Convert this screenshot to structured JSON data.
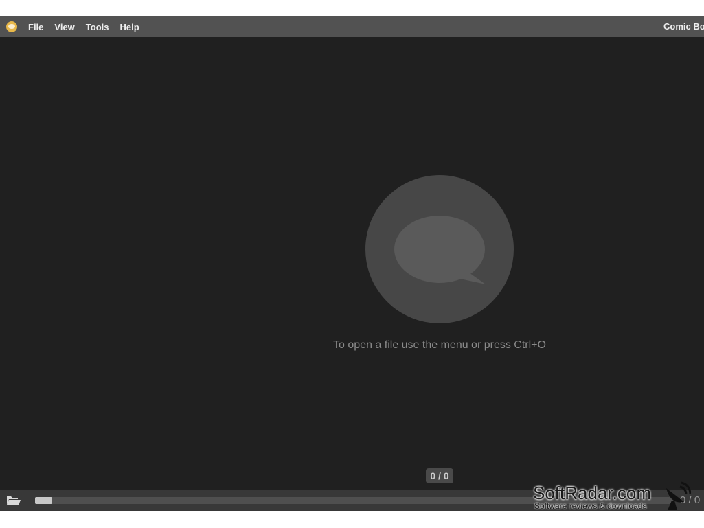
{
  "menubar": {
    "app_icon": "app-logo-icon",
    "items": [
      "File",
      "View",
      "Tools",
      "Help"
    ],
    "title": "Comic Bo"
  },
  "viewer": {
    "placeholder_icon": "speech-bubble-icon",
    "empty_message": "To open a file use the menu or press Ctrl+O",
    "page_indicator": "0 / 0"
  },
  "bottombar": {
    "open_icon": "folder-open-icon",
    "progress": 0,
    "page_count": "0 / 0"
  },
  "watermark": {
    "main": "SoftRadar.com",
    "sub": "Software reviews & downloads"
  },
  "colors": {
    "background": "#202020",
    "menubar": "#525252",
    "bottombar": "#383838",
    "accent": "#e8b84a"
  }
}
